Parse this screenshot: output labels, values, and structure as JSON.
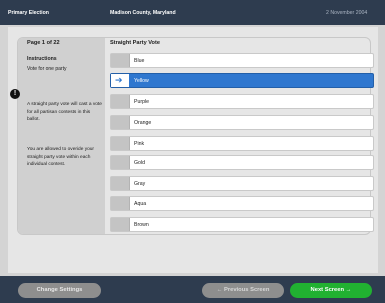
{
  "header": {
    "election": "Primary Election",
    "county": "Madison County, Maryland",
    "date": "2 November 2004"
  },
  "sidebar": {
    "page_label": "Page 1 of 22",
    "instructions_title": "Instructions",
    "instructions_sub": "Vote for one party",
    "alert_glyph": "!",
    "paragraph1": "A straight party vote will cast a vote for all partisan contests in this ballot.",
    "paragraph2": "You are allowed to overide your straight party vote within each individual contest."
  },
  "contest": {
    "title": "Straight Party Vote",
    "options": [
      {
        "label": "Blue",
        "selected": false
      },
      {
        "label": "Yellow",
        "selected": true
      },
      {
        "label": "Purple",
        "selected": false
      },
      {
        "label": "Orange",
        "selected": false
      },
      {
        "label": "Pink",
        "selected": false
      },
      {
        "label": "Gold",
        "selected": false
      },
      {
        "label": "Gray",
        "selected": false
      },
      {
        "label": "Aqua",
        "selected": false
      },
      {
        "label": "Brown",
        "selected": false
      }
    ],
    "selected_icon": "right-arrow-icon",
    "selected_glyph": "➔"
  },
  "footer": {
    "change_settings": "Change Settings",
    "previous": "← Previous Screen",
    "next": "Next Screen →"
  },
  "colors": {
    "header_bg": "#2e3c4f",
    "selected_bg": "#2f77cf",
    "next_button": "#21b131"
  }
}
